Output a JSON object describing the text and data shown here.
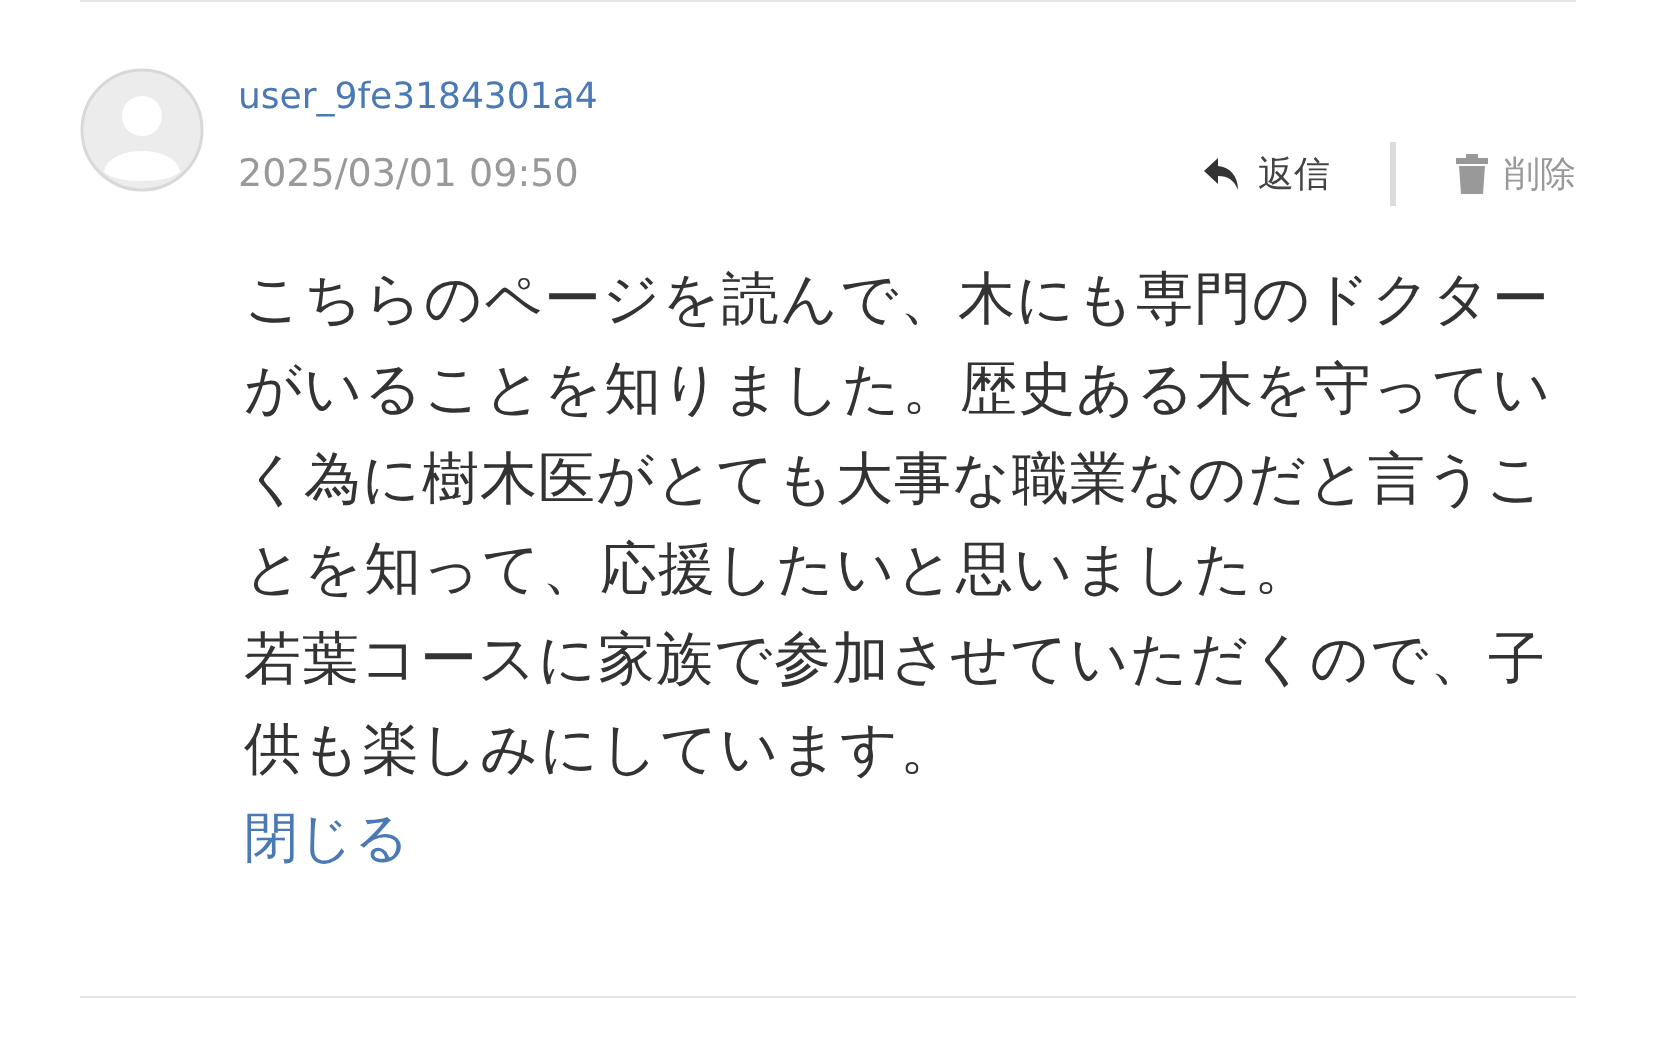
{
  "comment": {
    "username": "user_9fe3184301a4",
    "timestamp": "2025/03/01 09:50",
    "actions": [
      {
        "kind": "reply",
        "label": "返信"
      },
      {
        "kind": "delete",
        "label": "削除"
      }
    ],
    "body": [
      "こちらのページを読んで、木にも専門のドクターがいることを知りました。歴史ある木を守っていく為に樹木医がとても大事な職業なのだと言うことを知って、応援したいと思いました。",
      "若葉コースに家族で参加させていただくので、子供も楽しみにしています。"
    ],
    "toggle_link": "閉じる"
  }
}
